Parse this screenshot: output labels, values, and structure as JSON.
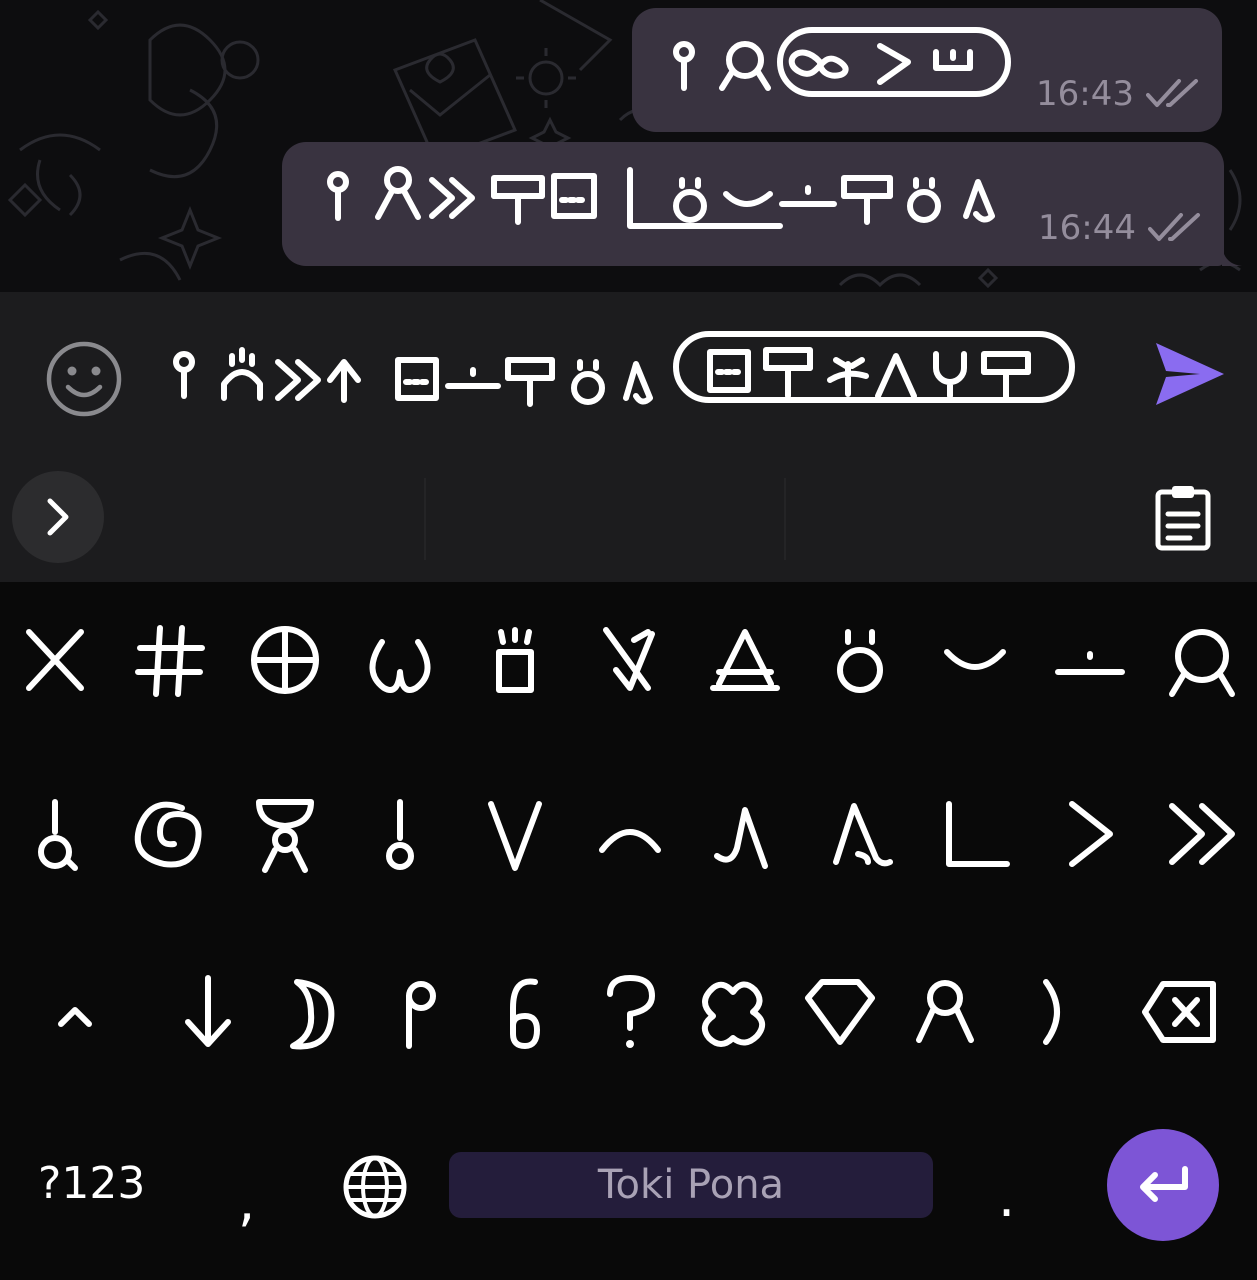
{
  "chat": {
    "messages": [
      {
        "time": "16:43",
        "status_icon": "double-check-icon",
        "glyphs": [
          "pi",
          "lukin",
          "cartouche:ale,suli,lupa"
        ]
      },
      {
        "time": "16:44",
        "status_icon": "double-check-icon",
        "glyphs": [
          "pi",
          "jan",
          "pana",
          "mama",
          "lipu",
          "open",
          "ona",
          "uta",
          "pona",
          "mama",
          "ona",
          "kama"
        ]
      }
    ]
  },
  "input": {
    "text_glyphs": [
      "pi",
      "pakala",
      "pana",
      "sewi",
      "lipu",
      "pona",
      "mama",
      "ona",
      "kama",
      "cartouche:lipu,mama,kasi,anpa,ike,mama"
    ]
  },
  "suggestions": {
    "expand_icon": "chevron-right-icon",
    "clipboard_icon": "clipboard-icon",
    "items": [
      "",
      "",
      ""
    ]
  },
  "keyboard": {
    "row1": [
      "ala",
      "kulupu",
      "ma",
      "mu",
      "lawa",
      "ilo",
      "nasin",
      "ona",
      "uta",
      "pona",
      "lukin"
    ],
    "row2": [
      "la",
      "sike",
      "jan-sewi",
      "anu",
      "kama-v",
      "sewi-arc",
      "tawa",
      "kama",
      "open",
      "suli",
      "pana"
    ],
    "row3": [
      "shift",
      "anpa",
      "mun",
      "pi",
      "linja",
      "seme",
      "kasi-blob",
      "kiwen",
      "jan",
      "en",
      "backspace"
    ],
    "symbols_label": "?123",
    "comma_label": ",",
    "space_label": "Toki Pona",
    "period_label": ".",
    "colors": {
      "accent": "#7d55d6",
      "space": "#241d3b",
      "bubble": "#393340"
    }
  }
}
